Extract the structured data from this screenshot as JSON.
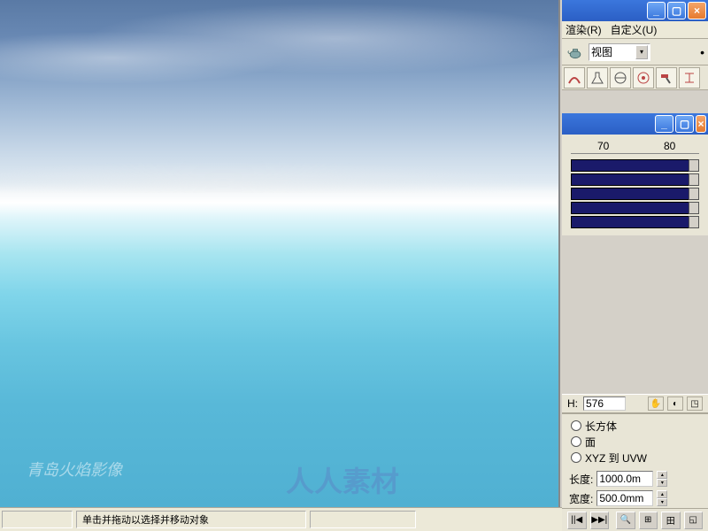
{
  "menu": {
    "render": "渲染(R)",
    "custom": "自定义(U)"
  },
  "dropdown": {
    "view": "视图"
  },
  "ruler": {
    "t70": "70",
    "t80": "80"
  },
  "coord": {
    "h_label": "H:",
    "h_value": "576"
  },
  "radios": {
    "box": "长方体",
    "face": "面",
    "xyz": "XYZ 到 UVW"
  },
  "params": {
    "length_label": "长度:",
    "length_value": "1000.0m",
    "width_label": "宽度:",
    "width_value": "500.0mm"
  },
  "status": {
    "hint": "单击并拖动以选择并移动对象"
  },
  "watermark": "青岛火焰影像",
  "watermark2": "人人素材"
}
